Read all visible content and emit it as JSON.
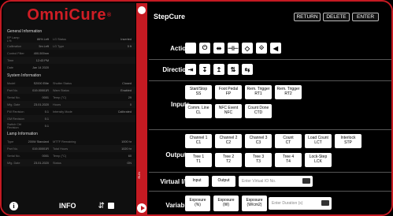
{
  "brand": {
    "name": "OmniCure",
    "reg": "®"
  },
  "general": {
    "title": "General Information",
    "rows": [
      {
        "k1": "EP Lamp L%",
        "v1": "86% Left",
        "k2": "LG Status",
        "v2": "Inserted"
      },
      {
        "k1": "Calibration",
        "v1": "5m Left",
        "k2": "LG Type",
        "v2": "5 ft"
      },
      {
        "k1": "Control Filter",
        "v1": "400-500nm",
        "k2": "",
        "v2": ""
      },
      {
        "k1": "Time",
        "v1": "12:43 PM",
        "k2": "",
        "v2": ""
      },
      {
        "k1": "Date",
        "v1": "Jan 14 2020",
        "k2": "",
        "v2": ""
      }
    ]
  },
  "system": {
    "title": "System Information",
    "rows": [
      {
        "k1": "Model",
        "v1": "S2000 Elite",
        "k2": "Shutter Status",
        "v2": "Closed"
      },
      {
        "k1": "Part No.",
        "v1": "019-00001R",
        "k2": "Warn Status",
        "v2": "Enabled"
      },
      {
        "k1": "Serial No.",
        "v1": "0001",
        "k2": "Temp (°C)",
        "v2": "29"
      },
      {
        "k1": "Mfg. Date",
        "v1": "23.01.2020",
        "k2": "Hours",
        "v2": "0"
      },
      {
        "k1": "FW Revision",
        "v1": "0.1",
        "k2": "Intensity Mode",
        "v2": "Calibrated"
      },
      {
        "k1": "GM Revision",
        "v1": "0.1",
        "k2": "",
        "v2": ""
      },
      {
        "k1": "Switch Ctrl Revision",
        "v1": "0.1",
        "k2": "",
        "v2": ""
      }
    ]
  },
  "lamp": {
    "title": "Lamp Information",
    "rows": [
      {
        "k1": "Type",
        "v1": "200W Standard",
        "k2": "MTTF Remaining",
        "v2": "1000 hr"
      },
      {
        "k1": "Part No.",
        "v1": "019-00001R",
        "k2": "Total Hours",
        "v2": "1020 hr"
      },
      {
        "k1": "Serial No.",
        "v1": "0001",
        "k2": "Temp (°C)",
        "v2": "60"
      },
      {
        "k1": "Mfg. Date",
        "v1": "23.01.2020",
        "k2": "Status",
        "v2": "ON"
      }
    ]
  },
  "bottom": {
    "info_label": "INFO",
    "info_glyph": "i",
    "usb_glyph": "⯈"
  },
  "strip": {
    "run_label": "RUN"
  },
  "main": {
    "title": "StepCure",
    "buttons": {
      "return": "RETURN",
      "delete": "DELETE",
      "enter": "ENTER"
    },
    "action": {
      "label": "Action",
      "icons": [
        "⏻",
        "⏻",
        "⊣⊢",
        "⊢⊣",
        "◇",
        "◆",
        "◀"
      ]
    },
    "direction": {
      "label": "Direction",
      "icons": [
        "⇥",
        "⇤",
        "⇡",
        "⇣",
        "⇄"
      ]
    },
    "inputs": {
      "label": "Inputs",
      "row1": [
        [
          "Start/Stop",
          "SS"
        ],
        [
          "Foot Pedal",
          "FP"
        ],
        [
          "Rem. Trigger",
          "RT1"
        ],
        [
          "Rem. Trigger",
          "RT2"
        ]
      ],
      "row2": [
        [
          "Comm. Line",
          "CL"
        ],
        [
          "NFC Event",
          "NFC"
        ],
        [
          "Count Done",
          "CTD"
        ]
      ]
    },
    "outputs": {
      "label": "Outputs",
      "row1": [
        [
          "Channel 1",
          "C1"
        ],
        [
          "Channel 2",
          "C2"
        ],
        [
          "Channel 3",
          "C3"
        ],
        [
          "Count",
          "CT"
        ],
        [
          "Load Count",
          "LCT"
        ],
        [
          "Interlock",
          "STP"
        ]
      ],
      "row2": [
        [
          "Tree 1",
          "T1"
        ],
        [
          "Tree 2",
          "T2"
        ],
        [
          "Tree 3",
          "T3"
        ],
        [
          "Tree 4",
          "T4"
        ],
        [
          "Lock-Step",
          "LCK"
        ]
      ]
    },
    "virtual": {
      "label": "Virtual I/O",
      "input": "Input",
      "output": "Output",
      "placeholder": "Enter Virtual IO No."
    },
    "variable": {
      "label": "Variable",
      "buttons": [
        [
          "Exposure",
          "(%)"
        ],
        [
          "Exposure",
          "(W)"
        ],
        [
          "Exposure",
          "(W/cm2)"
        ]
      ],
      "placeholder": "Enter Duration (s)"
    }
  }
}
